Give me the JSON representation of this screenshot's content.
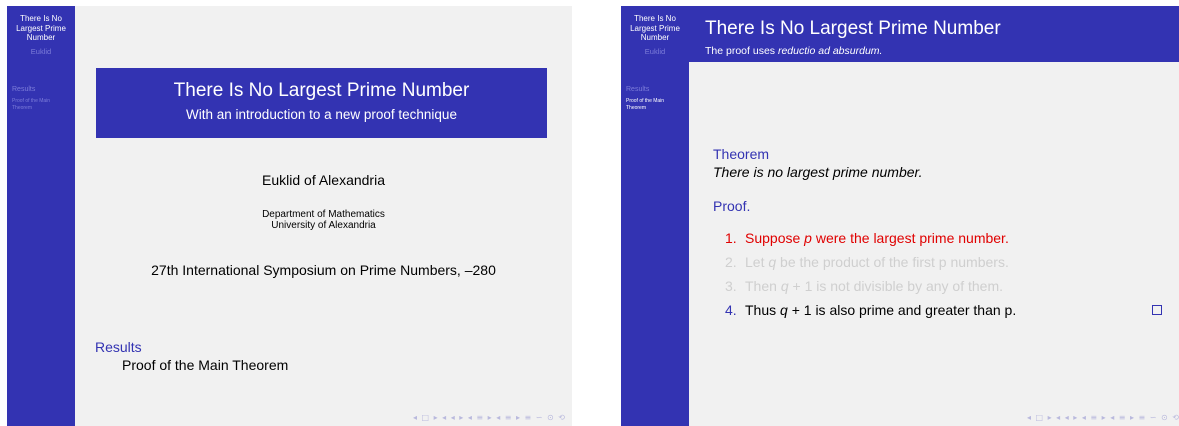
{
  "presentation": {
    "sidebar_title": "There Is No Largest Prime Number",
    "sidebar_author": "Euklid",
    "sidebar_section": "Results",
    "sidebar_subsection": "Proof of the Main Theorem",
    "nav_symbols": "◂ □ ▸ ◂ ◂ ▸ ◂ ≡ ▸ ◂ ≡ ▸ ≡ ∽ ⊙ ⟲"
  },
  "slide1": {
    "title": "There Is No Largest Prime Number",
    "subtitle": "With an introduction to a new proof technique",
    "author": "Euklid of Alexandria",
    "institute_line1": "Department of Mathematics",
    "institute_line2": "University of Alexandria",
    "conference": "27th International Symposium on Prime Numbers, –280",
    "toc_section": "Results",
    "toc_subsection": "Proof of the Main Theorem"
  },
  "slide2": {
    "frame_title": "There Is No Largest Prime Number",
    "frame_subtitle_prefix": "The proof uses ",
    "frame_subtitle_emph": "reductio ad absurdum.",
    "theorem_label": "Theorem",
    "theorem_text": "There is no largest prime number.",
    "proof_label": "Proof.",
    "items": [
      {
        "num": "1.",
        "pre": "Suppose ",
        "var": "p",
        "post": " were the largest prime number.",
        "style": "red"
      },
      {
        "num": "2.",
        "pre": "Let ",
        "var": "q",
        "post": " be the product of the first p numbers.",
        "style": "faded"
      },
      {
        "num": "3.",
        "pre": "Then ",
        "var": "q",
        "post": " + 1 is not divisible by any of them.",
        "style": "faded"
      },
      {
        "num": "4.",
        "pre": "Thus ",
        "var": "q",
        "post": " + 1 is also prime and greater than p.",
        "style": "normal"
      }
    ]
  }
}
